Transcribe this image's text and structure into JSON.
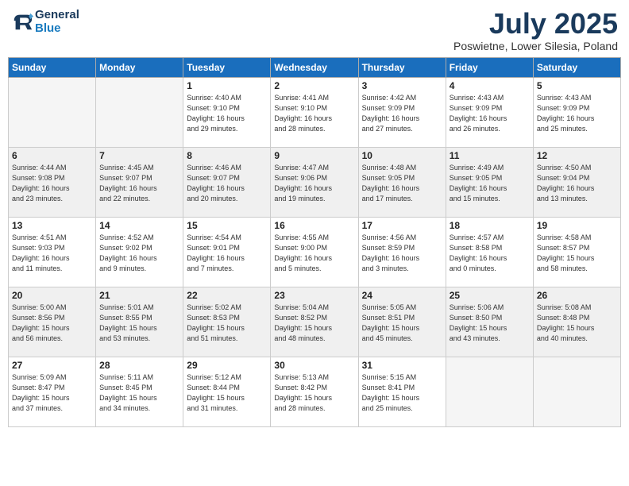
{
  "logo": {
    "line1": "General",
    "line2": "Blue"
  },
  "title": "July 2025",
  "location": "Poswietne, Lower Silesia, Poland",
  "weekdays": [
    "Sunday",
    "Monday",
    "Tuesday",
    "Wednesday",
    "Thursday",
    "Friday",
    "Saturday"
  ],
  "weeks": [
    [
      {
        "day": "",
        "info": ""
      },
      {
        "day": "",
        "info": ""
      },
      {
        "day": "1",
        "info": "Sunrise: 4:40 AM\nSunset: 9:10 PM\nDaylight: 16 hours\nand 29 minutes."
      },
      {
        "day": "2",
        "info": "Sunrise: 4:41 AM\nSunset: 9:10 PM\nDaylight: 16 hours\nand 28 minutes."
      },
      {
        "day": "3",
        "info": "Sunrise: 4:42 AM\nSunset: 9:09 PM\nDaylight: 16 hours\nand 27 minutes."
      },
      {
        "day": "4",
        "info": "Sunrise: 4:43 AM\nSunset: 9:09 PM\nDaylight: 16 hours\nand 26 minutes."
      },
      {
        "day": "5",
        "info": "Sunrise: 4:43 AM\nSunset: 9:09 PM\nDaylight: 16 hours\nand 25 minutes."
      }
    ],
    [
      {
        "day": "6",
        "info": "Sunrise: 4:44 AM\nSunset: 9:08 PM\nDaylight: 16 hours\nand 23 minutes."
      },
      {
        "day": "7",
        "info": "Sunrise: 4:45 AM\nSunset: 9:07 PM\nDaylight: 16 hours\nand 22 minutes."
      },
      {
        "day": "8",
        "info": "Sunrise: 4:46 AM\nSunset: 9:07 PM\nDaylight: 16 hours\nand 20 minutes."
      },
      {
        "day": "9",
        "info": "Sunrise: 4:47 AM\nSunset: 9:06 PM\nDaylight: 16 hours\nand 19 minutes."
      },
      {
        "day": "10",
        "info": "Sunrise: 4:48 AM\nSunset: 9:05 PM\nDaylight: 16 hours\nand 17 minutes."
      },
      {
        "day": "11",
        "info": "Sunrise: 4:49 AM\nSunset: 9:05 PM\nDaylight: 16 hours\nand 15 minutes."
      },
      {
        "day": "12",
        "info": "Sunrise: 4:50 AM\nSunset: 9:04 PM\nDaylight: 16 hours\nand 13 minutes."
      }
    ],
    [
      {
        "day": "13",
        "info": "Sunrise: 4:51 AM\nSunset: 9:03 PM\nDaylight: 16 hours\nand 11 minutes."
      },
      {
        "day": "14",
        "info": "Sunrise: 4:52 AM\nSunset: 9:02 PM\nDaylight: 16 hours\nand 9 minutes."
      },
      {
        "day": "15",
        "info": "Sunrise: 4:54 AM\nSunset: 9:01 PM\nDaylight: 16 hours\nand 7 minutes."
      },
      {
        "day": "16",
        "info": "Sunrise: 4:55 AM\nSunset: 9:00 PM\nDaylight: 16 hours\nand 5 minutes."
      },
      {
        "day": "17",
        "info": "Sunrise: 4:56 AM\nSunset: 8:59 PM\nDaylight: 16 hours\nand 3 minutes."
      },
      {
        "day": "18",
        "info": "Sunrise: 4:57 AM\nSunset: 8:58 PM\nDaylight: 16 hours\nand 0 minutes."
      },
      {
        "day": "19",
        "info": "Sunrise: 4:58 AM\nSunset: 8:57 PM\nDaylight: 15 hours\nand 58 minutes."
      }
    ],
    [
      {
        "day": "20",
        "info": "Sunrise: 5:00 AM\nSunset: 8:56 PM\nDaylight: 15 hours\nand 56 minutes."
      },
      {
        "day": "21",
        "info": "Sunrise: 5:01 AM\nSunset: 8:55 PM\nDaylight: 15 hours\nand 53 minutes."
      },
      {
        "day": "22",
        "info": "Sunrise: 5:02 AM\nSunset: 8:53 PM\nDaylight: 15 hours\nand 51 minutes."
      },
      {
        "day": "23",
        "info": "Sunrise: 5:04 AM\nSunset: 8:52 PM\nDaylight: 15 hours\nand 48 minutes."
      },
      {
        "day": "24",
        "info": "Sunrise: 5:05 AM\nSunset: 8:51 PM\nDaylight: 15 hours\nand 45 minutes."
      },
      {
        "day": "25",
        "info": "Sunrise: 5:06 AM\nSunset: 8:50 PM\nDaylight: 15 hours\nand 43 minutes."
      },
      {
        "day": "26",
        "info": "Sunrise: 5:08 AM\nSunset: 8:48 PM\nDaylight: 15 hours\nand 40 minutes."
      }
    ],
    [
      {
        "day": "27",
        "info": "Sunrise: 5:09 AM\nSunset: 8:47 PM\nDaylight: 15 hours\nand 37 minutes."
      },
      {
        "day": "28",
        "info": "Sunrise: 5:11 AM\nSunset: 8:45 PM\nDaylight: 15 hours\nand 34 minutes."
      },
      {
        "day": "29",
        "info": "Sunrise: 5:12 AM\nSunset: 8:44 PM\nDaylight: 15 hours\nand 31 minutes."
      },
      {
        "day": "30",
        "info": "Sunrise: 5:13 AM\nSunset: 8:42 PM\nDaylight: 15 hours\nand 28 minutes."
      },
      {
        "day": "31",
        "info": "Sunrise: 5:15 AM\nSunset: 8:41 PM\nDaylight: 15 hours\nand 25 minutes."
      },
      {
        "day": "",
        "info": ""
      },
      {
        "day": "",
        "info": ""
      }
    ]
  ]
}
